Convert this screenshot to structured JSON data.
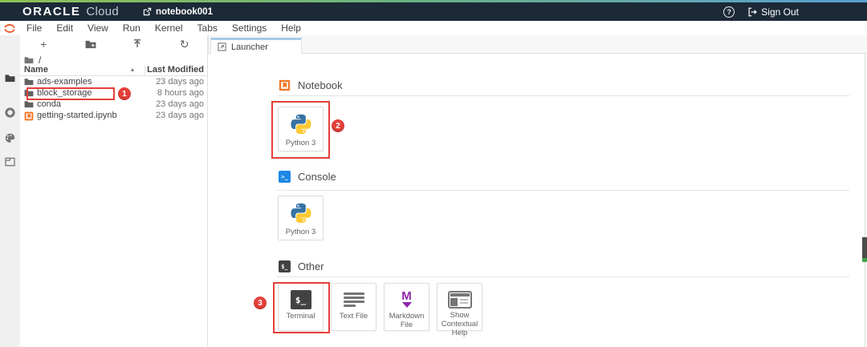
{
  "topbar": {
    "brand_primary": "ORACLE",
    "brand_secondary": "Cloud",
    "instance": "notebook001",
    "signout_label": "Sign Out"
  },
  "menubar": {
    "items": [
      "File",
      "Edit",
      "View",
      "Run",
      "Kernel",
      "Tabs",
      "Settings",
      "Help"
    ]
  },
  "file_browser": {
    "breadcrumb_root": "/",
    "columns": {
      "name": "Name",
      "modified": "Last Modified"
    },
    "files": [
      {
        "name": "ads-examples",
        "type": "folder",
        "modified": "23 days ago"
      },
      {
        "name": "block_storage",
        "type": "folder",
        "modified": "8 hours ago"
      },
      {
        "name": "conda",
        "type": "folder",
        "modified": "23 days ago"
      },
      {
        "name": "getting-started.ipynb",
        "type": "notebook",
        "modified": "23 days ago"
      }
    ]
  },
  "main": {
    "tab_label": "Launcher",
    "sections": [
      {
        "title": "Notebook",
        "icon": "notebook-icon",
        "cards": [
          {
            "label": "Python 3",
            "icon": "python-logo"
          }
        ]
      },
      {
        "title": "Console",
        "icon": "console-icon",
        "cards": [
          {
            "label": "Python 3",
            "icon": "python-logo"
          }
        ]
      },
      {
        "title": "Other",
        "icon": "terminal-icon",
        "cards": [
          {
            "label": "Terminal",
            "icon": "terminal"
          },
          {
            "label": "Text File",
            "icon": "text-file"
          },
          {
            "label": "Markdown File",
            "icon": "markdown"
          },
          {
            "label": "Show Contextual Help",
            "icon": "contextual-help"
          }
        ]
      }
    ]
  },
  "annotations": {
    "steps": [
      "1",
      "2",
      "3"
    ]
  },
  "icons": {
    "help": "?",
    "plus": "+",
    "refresh": "↻",
    "sort_asc": "▴",
    "terminal_glyph": "$_",
    "console_glyph": ">_",
    "markdown_glyph": "M"
  },
  "colors": {
    "topbar_bg": "#1c2937",
    "gradient_left": "#8fc054",
    "gradient_right": "#5b9fd4",
    "annotation_red": "#e5403a",
    "tab_accent": "#a6cbe8",
    "notebook_orange": "#f37726",
    "console_blue": "#1e88e5",
    "markdown_purple": "#8e24aa",
    "python_blue": "#3873a3",
    "python_yellow": "#fec933",
    "scroll_green": "#43a047"
  }
}
